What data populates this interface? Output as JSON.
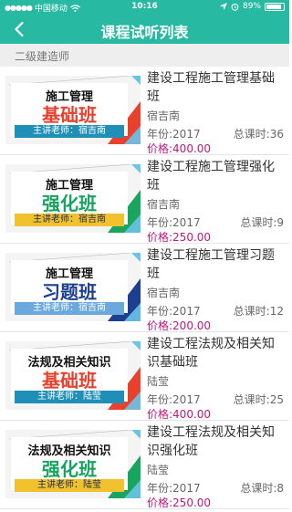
{
  "status": {
    "carrier": "中国移动",
    "time": "10:16",
    "battery": "89%",
    "battery_level": 0.89
  },
  "nav": {
    "title": "课程试听列表"
  },
  "section": {
    "label": "二级建造师"
  },
  "courses": [
    {
      "thumb": {
        "title": "施工管理",
        "big": "基础班",
        "teacher": "主讲老师：宿吉南",
        "big_color": "#e8412e",
        "bar_color": "#1f8fb7",
        "accent": "#e8412e"
      },
      "name": "建设工程施工管理基础班",
      "teacher": "宿吉南",
      "year": "年份:2017",
      "hours": "总课时:36",
      "price": "价格:400.00"
    },
    {
      "thumb": {
        "title": "施工管理",
        "big": "强化班",
        "teacher": "主讲老师：宿吉南",
        "big_color": "#16a35f",
        "bar_color": "#f2c12e",
        "accent": "#1aa55f"
      },
      "name": "建设工程施工管理强化班",
      "teacher": "宿吉南",
      "year": "年份:2017",
      "hours": "总课时:9",
      "price": "价格:250.00"
    },
    {
      "thumb": {
        "title": "施工管理",
        "big": "习题班",
        "teacher": "主讲老师：宿吉南",
        "big_color": "#1d3f8f",
        "bar_color": "#6aa8de",
        "accent": "#1d3f8f"
      },
      "name": "建设工程施工管理习题班",
      "teacher": "宿吉南",
      "year": "年份:2017",
      "hours": "总课时:12",
      "price": "价格:200.00"
    },
    {
      "thumb": {
        "title": "法规及相关知识",
        "big": "基础班",
        "teacher": "主讲老师：陆莹",
        "big_color": "#e8412e",
        "bar_color": "#1f8fb7",
        "accent": "#e8412e"
      },
      "name": "建设工程法规及相关知识基础班",
      "teacher": "陆莹",
      "year": "年份:2017",
      "hours": "总课时:25",
      "price": "价格:400.00"
    },
    {
      "thumb": {
        "title": "法规及相关知识",
        "big": "强化班",
        "teacher": "主讲老师：陆莹",
        "big_color": "#16a35f",
        "bar_color": "#f2c12e",
        "accent": "#1aa55f"
      },
      "name": "建设工程法规及相关知识强化班",
      "teacher": "陆莹",
      "year": "年份:2017",
      "hours": "总课时:8",
      "price": "价格:250.00"
    }
  ]
}
